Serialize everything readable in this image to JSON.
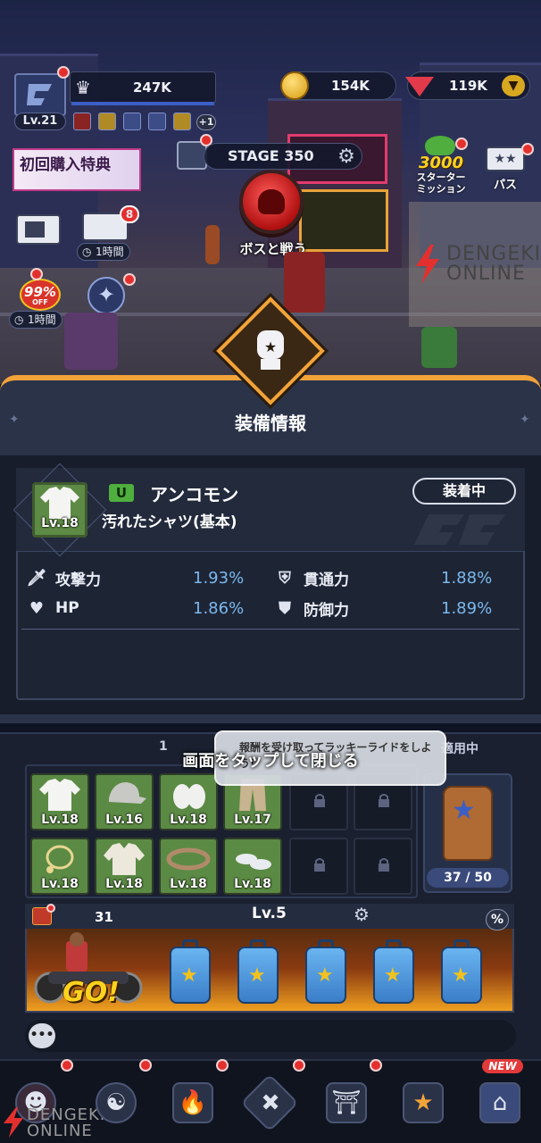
{
  "hud": {
    "player_level": "Lv.21",
    "power": "247K",
    "coins": "154K",
    "gems": "119K",
    "plus_label": "+1",
    "promo_label": "初回購入特典",
    "stage_label": "STAGE 350",
    "boss_label": "ボスと戦う",
    "starter_mission_count": "3000",
    "starter_mission_label": "スターター\nミッション",
    "pass_label": "パス",
    "ad_chest_badge": "8",
    "ad_chest_timer": "1時間",
    "discount_label": "99%",
    "discount_sub": "OFF",
    "discount_timer": "1時間"
  },
  "watermark": {
    "line1": "DENGEKI",
    "line2": "ONLINE"
  },
  "equipment_panel": {
    "title": "装備情報",
    "item": {
      "level": "Lv.18",
      "rarity_icon": "U",
      "rarity": "アンコモン",
      "name": "汚れたシャツ(基本)",
      "status_button": "装着中"
    },
    "stats": [
      {
        "icon": "sword-icon",
        "label": "攻撃力",
        "value": "1.93%"
      },
      {
        "icon": "pierce-shield-icon",
        "label": "貫通力",
        "value": "1.88%"
      },
      {
        "icon": "heart-icon",
        "label": "HP",
        "value": "1.86%"
      },
      {
        "icon": "shield-icon",
        "label": "防御力",
        "value": "1.89%"
      }
    ]
  },
  "inventory": {
    "tab_number": "1",
    "applied_label": "適用中",
    "tooltip_text": "報酬を受け取ってラッキーライドをしよう!",
    "tap_to_close": "画面をタップして閉じる",
    "slots_row1": [
      "Lv.18",
      "Lv.16",
      "Lv.18",
      "Lv.17"
    ],
    "slots_row2": [
      "Lv.18",
      "Lv.18",
      "Lv.18",
      "Lv.18"
    ],
    "bag_count": "37 / 50"
  },
  "luggage": {
    "count": "31",
    "level": "Lv.5",
    "percent_label": "%",
    "go_label": "GO!"
  },
  "nav": {
    "new_badge": "NEW"
  },
  "colors": {
    "accent_orange": "#f2a33a",
    "stat_value_blue": "#7bb8ee",
    "uncommon_green": "#4fae3e",
    "alert_red": "#e3302e"
  }
}
